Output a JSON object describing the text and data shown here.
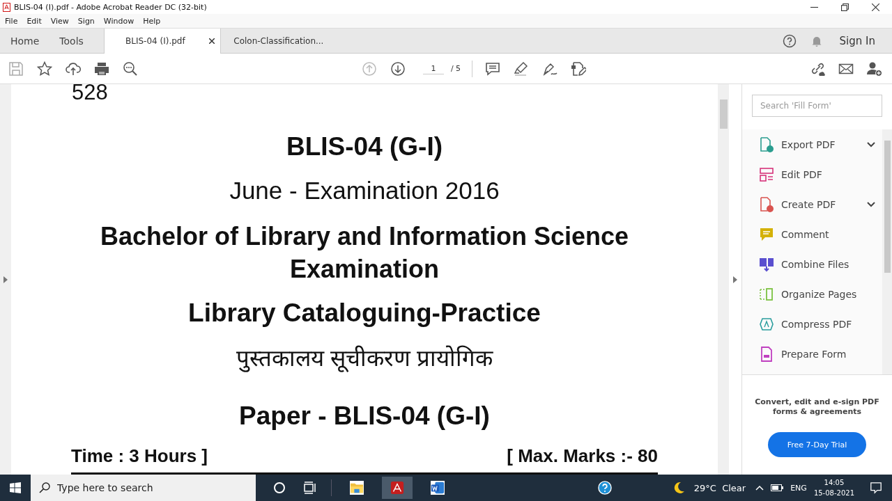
{
  "window": {
    "title": "BLIS-04 (I).pdf - Adobe Acrobat Reader DC (32-bit)"
  },
  "menu": [
    "File",
    "Edit",
    "View",
    "Sign",
    "Window",
    "Help"
  ],
  "nav": [
    "Home",
    "Tools"
  ],
  "tabs": [
    {
      "label": "BLIS-04 (I).pdf",
      "selected": true
    },
    {
      "label": "Colon-Classification...",
      "selected": false
    }
  ],
  "sign_in": "Sign In",
  "page": {
    "current": "1",
    "total": "/ 5"
  },
  "document": {
    "cut_line": "528",
    "code": "BLIS-04 (G-I)",
    "session": "June - Examination 2016",
    "degree": "Bachelor of Library and Information Science Examination",
    "subject": "Library Cataloguing-Practice",
    "subject_hindi": "पुस्तकालय सूचीकरण प्रायोगिक",
    "paper": "Paper - BLIS-04 (G-I)",
    "time": "Time : 3 Hours ]",
    "marks": "[ Max. Marks :- 80"
  },
  "panel": {
    "search": {
      "placeholder": "Search 'Fill Form'"
    },
    "tools": [
      {
        "label": "Export PDF",
        "kind": "export",
        "expandable": true
      },
      {
        "label": "Edit PDF",
        "kind": "edit",
        "expandable": false
      },
      {
        "label": "Create PDF",
        "kind": "create",
        "expandable": true
      },
      {
        "label": "Comment",
        "kind": "comment",
        "expandable": false
      },
      {
        "label": "Combine Files",
        "kind": "combine",
        "expandable": false
      },
      {
        "label": "Organize Pages",
        "kind": "organize",
        "expandable": false
      },
      {
        "label": "Compress PDF",
        "kind": "compress",
        "expandable": false
      },
      {
        "label": "Prepare Form",
        "kind": "prepare",
        "expandable": false
      }
    ],
    "promo": "Convert, edit and e-sign PDF forms & agreements",
    "trial": "Free 7-Day Trial"
  },
  "taskbar": {
    "search": {
      "placeholder": "Type here to search"
    },
    "weather": "29°C  Clear",
    "language": "ENG",
    "time": "14:05",
    "date": "15-08-2021"
  }
}
